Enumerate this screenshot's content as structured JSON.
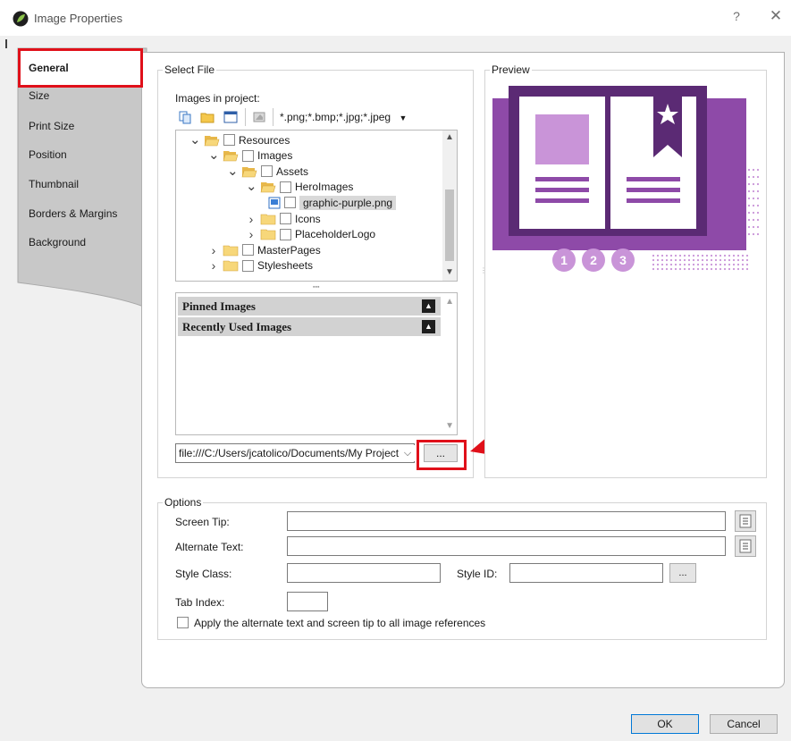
{
  "window": {
    "title": "Image Properties",
    "help": "?",
    "close": "✕"
  },
  "nav": {
    "items": [
      "General",
      "Size",
      "Print Size",
      "Position",
      "Thumbnail",
      "Borders & Margins",
      "Background"
    ],
    "active": "General"
  },
  "select_file": {
    "legend": "Select File",
    "images_label": "Images in project:",
    "filter": "*.png;*.bmp;*.jpg;*.jpeg",
    "tree": [
      {
        "label": "Resources",
        "depth": 0,
        "expanded": true
      },
      {
        "label": "Images",
        "depth": 1,
        "expanded": true
      },
      {
        "label": "Assets",
        "depth": 2,
        "expanded": true
      },
      {
        "label": "HeroImages",
        "depth": 3,
        "expanded": true
      },
      {
        "label": "graphic-purple.png",
        "depth": 4,
        "file": true,
        "selected": true
      },
      {
        "label": "Icons",
        "depth": 3,
        "expanded": false
      },
      {
        "label": "PlaceholderLogo",
        "depth": 3,
        "expanded": false
      },
      {
        "label": "MasterPages",
        "depth": 1,
        "expanded": false
      },
      {
        "label": "Stylesheets",
        "depth": 1,
        "expanded": false
      }
    ],
    "pinned_label": "Pinned Images",
    "recent_label": "Recently Used Images",
    "path_value": "file:///C:/Users/jcatolico/Documents/My Project",
    "browse_label": "..."
  },
  "preview": {
    "legend": "Preview",
    "badges": [
      "1",
      "2",
      "3"
    ],
    "colors": {
      "dark": "#5b2a74",
      "mid": "#8e4aa8",
      "light": "#c994d8",
      "pale": "#e3c9ec"
    }
  },
  "options": {
    "legend": "Options",
    "screen_tip_label": "Screen Tip:",
    "alt_text_label": "Alternate Text:",
    "style_class_label": "Style Class:",
    "style_id_label": "Style ID:",
    "tab_index_label": "Tab Index:",
    "apply_label": "Apply the alternate text and screen tip to all image references",
    "style_id_browse": "..."
  },
  "footer": {
    "ok": "OK",
    "cancel": "Cancel"
  },
  "annotation_color": "#e0101a"
}
